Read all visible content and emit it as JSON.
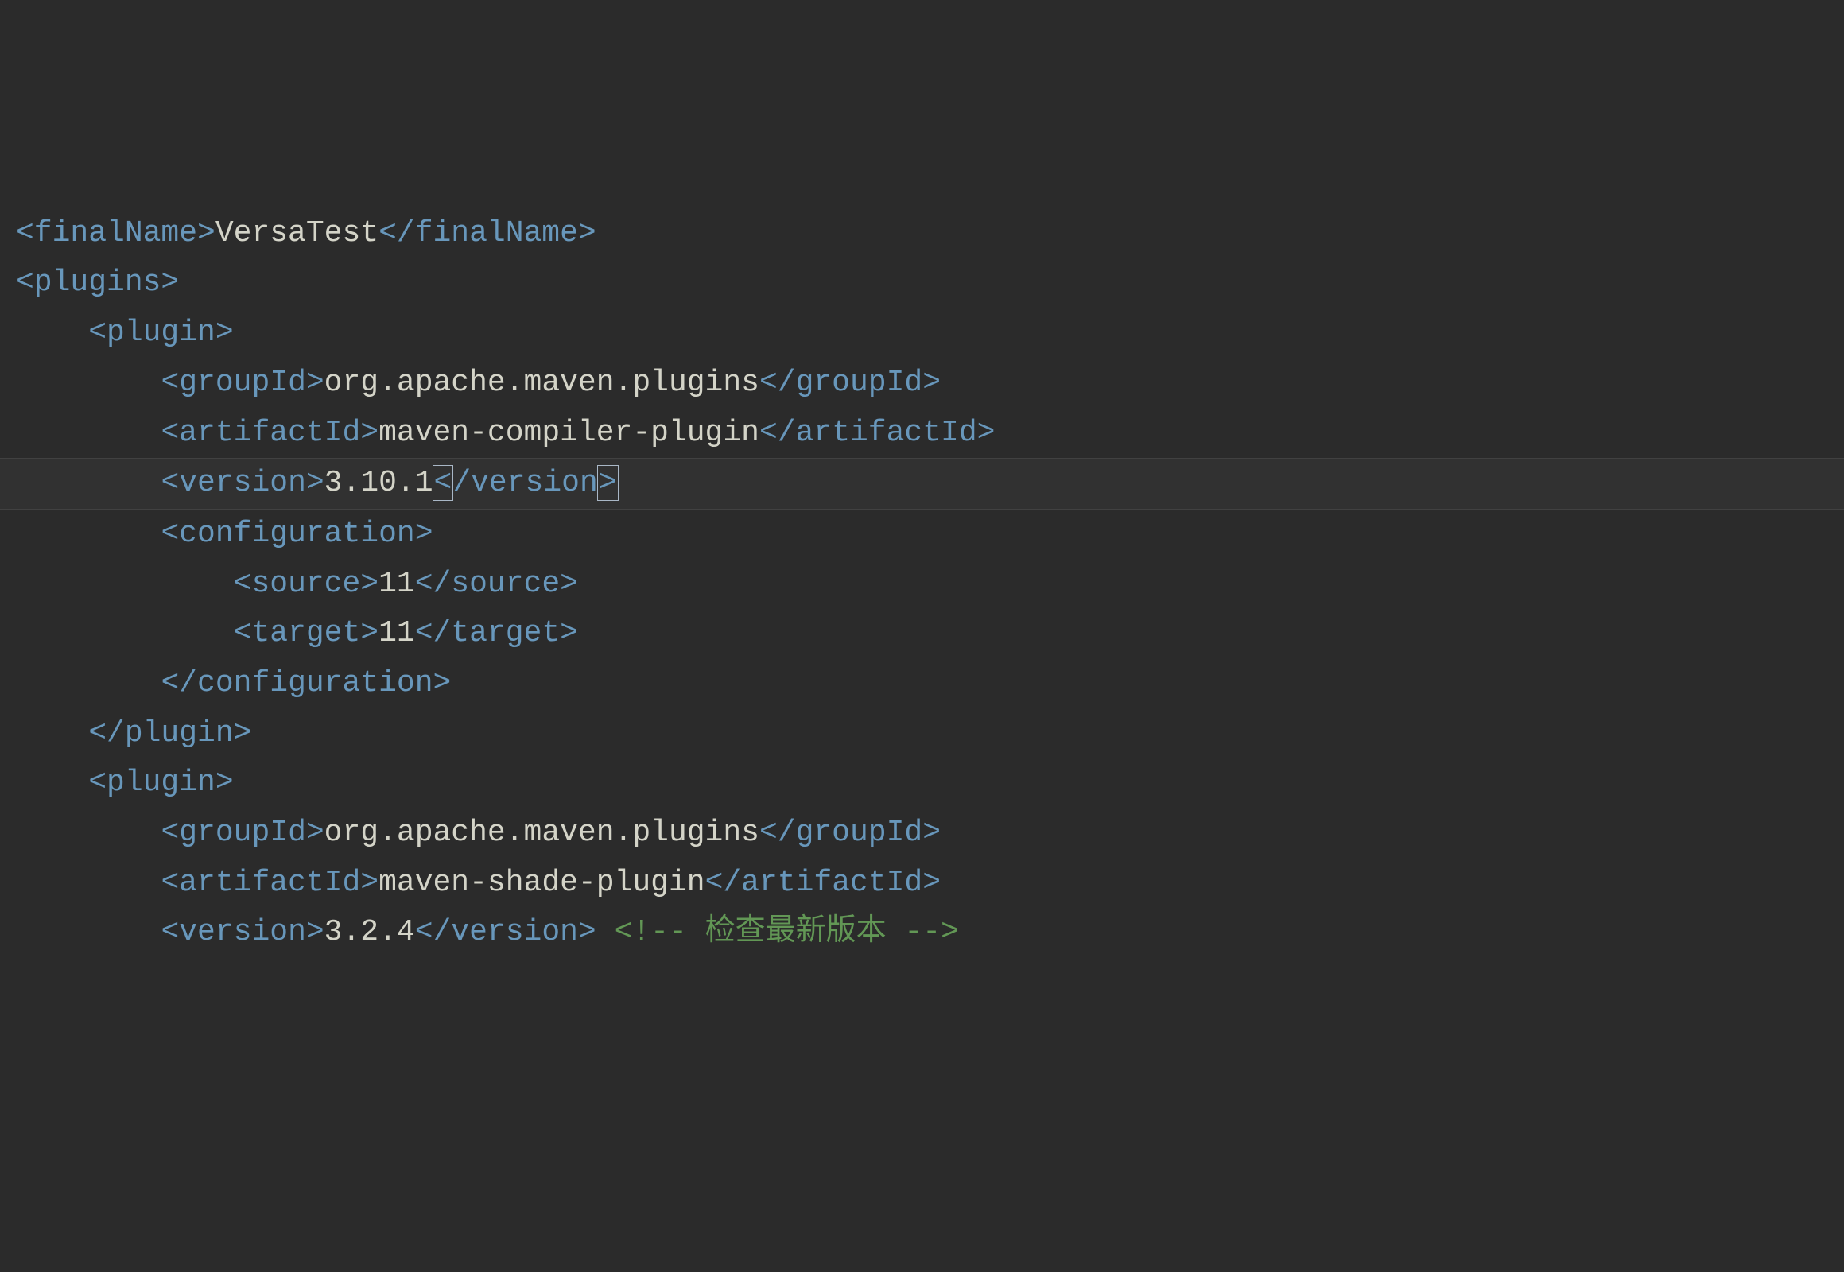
{
  "line1": {
    "open": "<finalName>",
    "text": "VersaTest",
    "close": "</finalName>"
  },
  "line2": {
    "open": "<plugins>"
  },
  "line3": {
    "open": "<plugin>"
  },
  "line4": {
    "open": "<groupId>",
    "text": "org.apache.maven.plugins",
    "close": "</groupId>"
  },
  "line5": {
    "open": "<artifactId>",
    "text": "maven-compiler-plugin",
    "close": "</artifactId>"
  },
  "line6": {
    "open": "<version>",
    "text": "3.10.1",
    "closeA": "<",
    "closeB": "/version",
    "closeC": ">"
  },
  "line7": {
    "open": "<configuration>"
  },
  "line8": {
    "open": "<source>",
    "text": "11",
    "close": "</source>"
  },
  "line9": {
    "open": "<target>",
    "text": "11",
    "close": "</target>"
  },
  "line10": {
    "close": "</configuration>"
  },
  "line11": {
    "close": "</plugin>"
  },
  "line12": {
    "open": "<plugin>"
  },
  "line13": {
    "open": "<groupId>",
    "text": "org.apache.maven.plugins",
    "close": "</groupId>"
  },
  "line14": {
    "open": "<artifactId>",
    "text": "maven-shade-plugin",
    "close": "</artifactId>"
  },
  "line15": {
    "open": "<version>",
    "text": "3.2.4",
    "close": "</version>",
    "comment": "<!-- 检查最新版本 -->"
  }
}
